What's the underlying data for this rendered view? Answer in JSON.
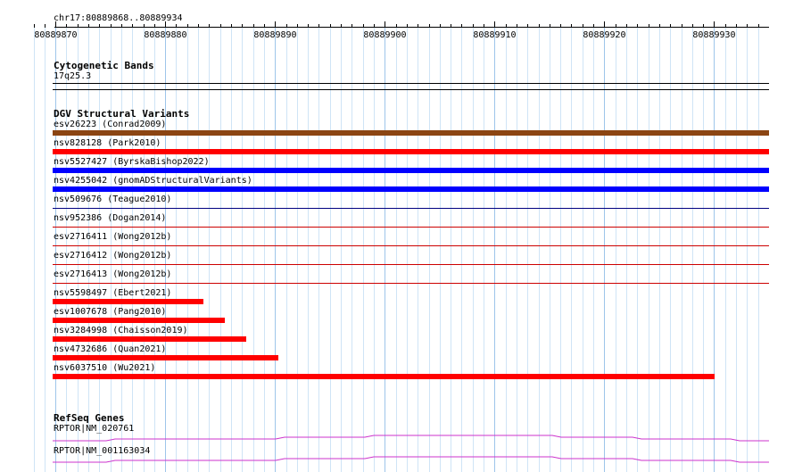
{
  "ruler": {
    "range_label": "chr17:80889868..80889934",
    "ticks": [
      "80889870",
      "80889880",
      "80889890",
      "80889900",
      "80889910",
      "80889920",
      "80889930"
    ]
  },
  "cyto": {
    "title": "Cytogenetic Bands",
    "band": "17q25.3"
  },
  "dgv": {
    "title": "DGV Structural Variants",
    "colors": {
      "brown": "#8b4513",
      "red": "#ff0000",
      "blue": "#0000ff",
      "thin_red": "#cc0000",
      "thin_blue": "#000080"
    },
    "variants": [
      {
        "label": "esv26223 (Conrad2009)"
      },
      {
        "label": "nsv828128 (Park2010)"
      },
      {
        "label": "nsv5527427 (ByrskaBishop2022)"
      },
      {
        "label": "nsv4255042 (gnomADStructuralVariants)"
      },
      {
        "label": "nsv509676 (Teague2010)"
      },
      {
        "label": "nsv952386 (Dogan2014)"
      },
      {
        "label": "esv2716411 (Wong2012b)"
      },
      {
        "label": "esv2716412 (Wong2012b)"
      },
      {
        "label": "esv2716413 (Wong2012b)"
      },
      {
        "label": "nsv5598497 (Ebert2021)"
      },
      {
        "label": "esv1007678 (Pang2010)"
      },
      {
        "label": "nsv3284998 (Chaisson2019)"
      },
      {
        "label": "nsv4732686 (Quan2021)"
      },
      {
        "label": "nsv6037510 (Wu2021)"
      }
    ]
  },
  "refseq": {
    "title": "RefSeq Genes",
    "genes": [
      {
        "label": "RPTOR|NM_020761"
      },
      {
        "label": "RPTOR|NM_001163034"
      }
    ],
    "color": "#cc33cc"
  }
}
